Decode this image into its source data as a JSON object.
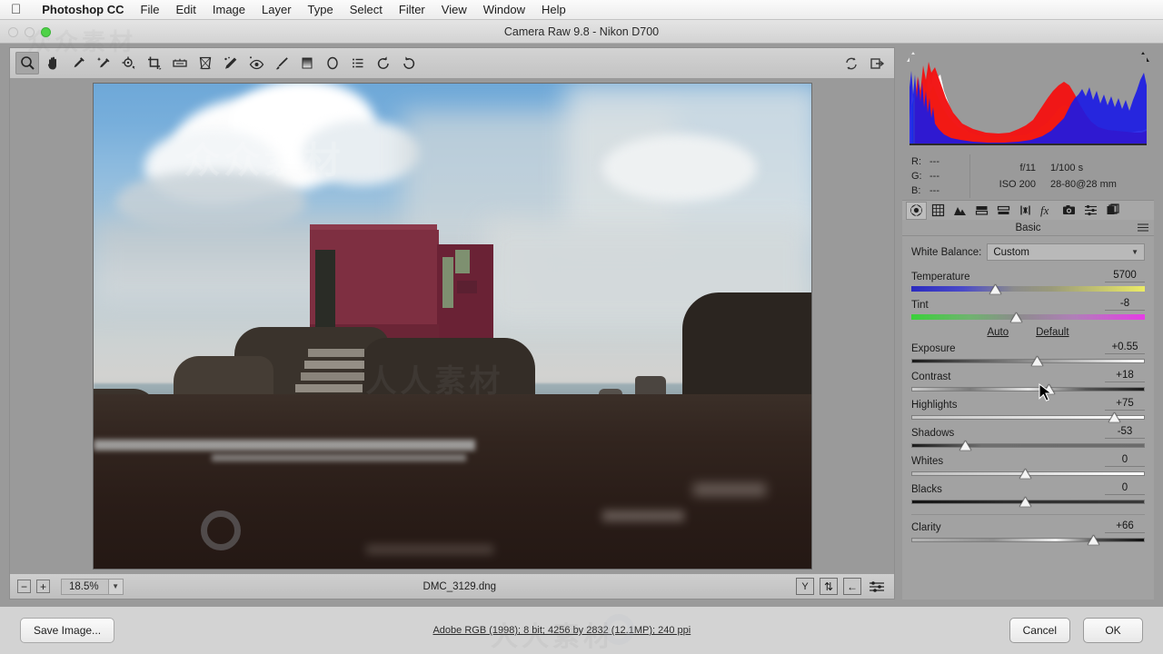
{
  "menubar": {
    "apple_icon": "apple-logo-icon",
    "items": [
      {
        "label": "Photoshop CC",
        "bold": true
      },
      {
        "label": "File",
        "bold": false
      },
      {
        "label": "Edit",
        "bold": false
      },
      {
        "label": "Image",
        "bold": false
      },
      {
        "label": "Layer",
        "bold": false
      },
      {
        "label": "Type",
        "bold": false
      },
      {
        "label": "Select",
        "bold": false
      },
      {
        "label": "Filter",
        "bold": false
      },
      {
        "label": "View",
        "bold": false
      },
      {
        "label": "Window",
        "bold": false
      },
      {
        "label": "Help",
        "bold": false
      }
    ]
  },
  "window": {
    "title": "Camera Raw 9.8  -  Nikon D700"
  },
  "toolbar": {
    "tools": [
      {
        "name": "zoom-tool",
        "active": true
      },
      {
        "name": "hand-tool",
        "active": false
      },
      {
        "name": "white-balance-tool",
        "active": false
      },
      {
        "name": "color-sampler-tool",
        "active": false
      },
      {
        "name": "targeted-adjustment-tool",
        "active": false
      },
      {
        "name": "crop-tool",
        "active": false
      },
      {
        "name": "straighten-tool",
        "active": false
      },
      {
        "name": "transform-tool",
        "active": false
      },
      {
        "name": "spot-removal-tool",
        "active": false
      },
      {
        "name": "red-eye-removal-tool",
        "active": false
      },
      {
        "name": "adjustment-brush-tool",
        "active": false
      },
      {
        "name": "graduated-filter-tool",
        "active": false
      },
      {
        "name": "radial-filter-tool",
        "active": false
      },
      {
        "name": "preset-list-tool",
        "active": false
      },
      {
        "name": "rotate-counterclockwise-tool",
        "active": false
      },
      {
        "name": "rotate-clockwise-tool",
        "active": false
      }
    ],
    "right_tools": [
      {
        "name": "toggle-preview-icon"
      },
      {
        "name": "full-screen-icon"
      }
    ]
  },
  "statusbar": {
    "zoom_out_label": "−",
    "zoom_in_label": "+",
    "zoom_value": "18.5%",
    "filename": "DMC_3129.dng",
    "buttons": [
      {
        "name": "preview-y-button",
        "label": "Y"
      },
      {
        "name": "swap-before-after-button",
        "label": "⇅"
      },
      {
        "name": "copy-settings-button",
        "label": "←"
      },
      {
        "name": "preferences-button",
        "label": "sliders"
      }
    ]
  },
  "histogram": {
    "clip_shadow_icon": "shadow-clipping-indicator",
    "clip_highlight_icon": "highlight-clipping-indicator"
  },
  "info": {
    "rgb": [
      {
        "label": "R:",
        "value": "---"
      },
      {
        "label": "G:",
        "value": "---"
      },
      {
        "label": "B:",
        "value": "---"
      }
    ],
    "exif": [
      {
        "left": "f/11",
        "right": "1/100 s"
      },
      {
        "left": "ISO 200",
        "right": "28-80@28 mm"
      }
    ]
  },
  "panel_tabs": [
    {
      "name": "tab-basic",
      "icon": "aperture-icon",
      "active": true
    },
    {
      "name": "tab-tone-curve",
      "icon": "tone-curve-icon",
      "active": false
    },
    {
      "name": "tab-detail",
      "icon": "detail-triangles-icon",
      "active": false
    },
    {
      "name": "tab-hsl-grayscale",
      "icon": "hsl-icon",
      "active": false
    },
    {
      "name": "tab-split-toning",
      "icon": "split-toning-icon",
      "active": false
    },
    {
      "name": "tab-lens-corrections",
      "icon": "lens-corrections-icon",
      "active": false
    },
    {
      "name": "tab-effects",
      "icon": "fx-icon",
      "active": false
    },
    {
      "name": "tab-camera-calibration",
      "icon": "camera-icon",
      "active": false
    },
    {
      "name": "tab-presets",
      "icon": "presets-sliders-icon",
      "active": false
    },
    {
      "name": "tab-snapshots",
      "icon": "snapshots-icon",
      "active": false
    }
  ],
  "panel": {
    "title": "Basic",
    "menu_icon": "panel-menu-icon",
    "white_balance": {
      "label": "White Balance:",
      "value": "Custom",
      "caret_icon": "chevron-down-icon"
    },
    "auto_label": "Auto",
    "default_label": "Default",
    "sliders": [
      {
        "label": "Temperature",
        "value": "5700",
        "pos": 36,
        "style": "temp"
      },
      {
        "label": "Tint",
        "value": "-8",
        "pos": 45,
        "style": "tint"
      },
      {
        "label": "Exposure",
        "value": "+0.55",
        "pos": 54,
        "style": "expo"
      },
      {
        "label": "Contrast",
        "value": "+18",
        "pos": 59,
        "style": "contrast"
      },
      {
        "label": "Highlights",
        "value": "+75",
        "pos": 87,
        "style": "highlights"
      },
      {
        "label": "Shadows",
        "value": "-53",
        "pos": 23,
        "style": "shadows"
      },
      {
        "label": "Whites",
        "value": "0",
        "pos": 49,
        "style": "whites"
      },
      {
        "label": "Blacks",
        "value": "0",
        "pos": 49,
        "style": "blacks"
      },
      {
        "label": "Clarity",
        "value": "+66",
        "pos": 78,
        "style": "clarity"
      }
    ]
  },
  "bottombar": {
    "save_label": "Save Image...",
    "workflow_options": "Adobe RGB (1998); 8 bit; 4256 by 2832 (12.1MP); 240 ppi",
    "cancel_label": "Cancel",
    "ok_label": "OK"
  },
  "photo": {
    "description": "Coastal seascape: weathered dark-red concrete building with green window frames on dark rocky outcrop, concrete steps, breaking surf, sea stacks, large white cumulus clouds in blue sky, dark seaweed-covered beach in foreground"
  },
  "watermarks": {
    "text_top": "众众素材",
    "text_center": "人人素材",
    "site": "rr素材"
  }
}
